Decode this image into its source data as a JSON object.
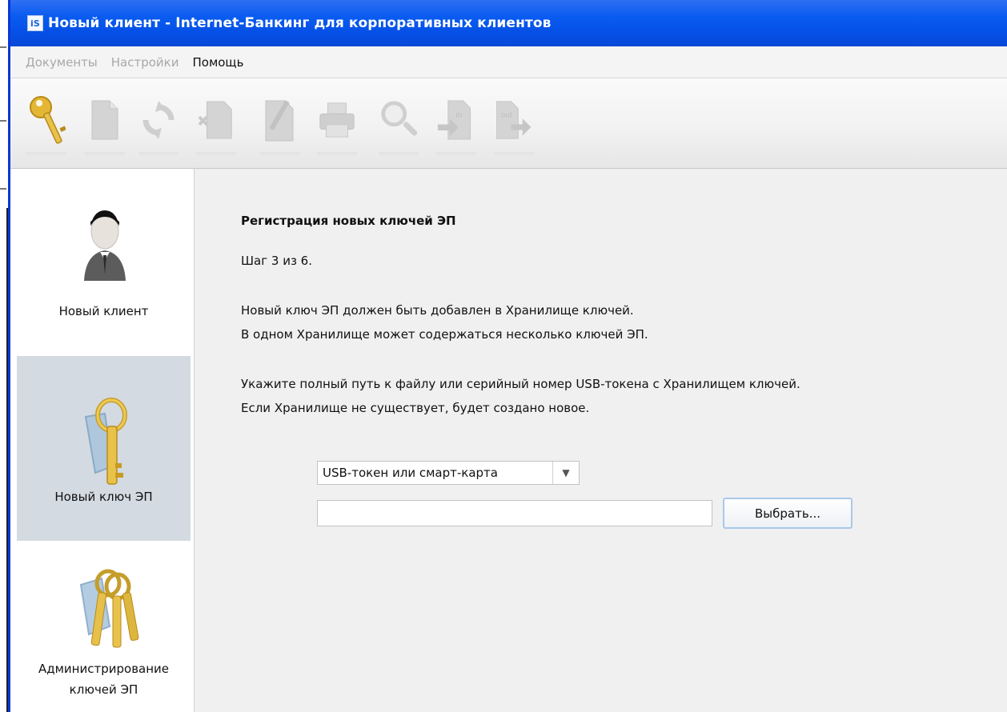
{
  "window": {
    "title": "Новый клиент - Internet-Банкинг для корпоративных клиентов",
    "icon_label": "iS"
  },
  "menu": [
    {
      "label": "Документы",
      "enabled": false
    },
    {
      "label": "Настройки",
      "enabled": false
    },
    {
      "label": "Помощь",
      "enabled": true
    }
  ],
  "toolbar": {
    "buttons": [
      {
        "icon": "key-icon",
        "enabled": true
      },
      {
        "icon": "new-document-icon",
        "enabled": false
      },
      {
        "icon": "refresh-icon",
        "enabled": false
      },
      {
        "icon": "delete-document-icon",
        "enabled": false
      },
      {
        "icon": "edit-document-icon",
        "enabled": false
      },
      {
        "icon": "print-icon",
        "enabled": false
      },
      {
        "icon": "search-icon",
        "enabled": false
      },
      {
        "icon": "import-icon",
        "enabled": false,
        "badge": "in"
      },
      {
        "icon": "export-icon",
        "enabled": false,
        "badge": "out"
      }
    ]
  },
  "sidebar": {
    "items": [
      {
        "label": "Новый клиент",
        "icon": "user-icon",
        "active": false
      },
      {
        "label": "Новый ключ ЭП",
        "icon": "key-icon",
        "active": true
      },
      {
        "label": "Администрирование\nключей ЭП",
        "icon": "keys-admin-icon",
        "active": false
      }
    ]
  },
  "main": {
    "heading": "Регистрация новых ключей ЭП",
    "step": "Шаг 3 из 6.",
    "paragraph1": [
      "Новый ключ ЭП должен быть добавлен в Хранилище ключей.",
      "В одном Хранилище может содержаться несколько ключей ЭП."
    ],
    "paragraph2": [
      "Укажите полный путь к файлу или серийный номер USB-токена с Хранилищем ключей.",
      "Если Хранилище не существует, будет создано новое."
    ],
    "storage_type": {
      "selected": "USB-токен или смарт-карта"
    },
    "path_input": {
      "value": "",
      "placeholder": ""
    },
    "choose_button": "Выбрать..."
  },
  "colors": {
    "titlebar": "#0a5cf0",
    "sidebar_active": "#d3dae2",
    "content_bg": "#f0f0f0",
    "key_gold": "#e8c24a",
    "disabled_icon": "#c8c8c8"
  }
}
